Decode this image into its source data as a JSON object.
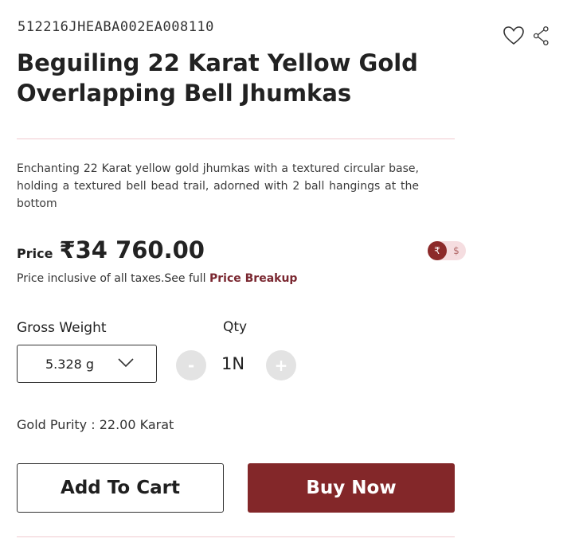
{
  "product": {
    "sku": "512216JHEABA002EA008110",
    "title": "Beguiling 22 Karat Yellow Gold Overlapping Bell Jhumkas",
    "description": "Enchanting 22 Karat yellow gold jhumkas with a textured circular base, holding a textured bell bead trail, adorned with 2 ball hangings at the bottom",
    "purity": "Gold Purity : 22.00 Karat"
  },
  "icons": {
    "wishlist": "heart-icon",
    "share": "share-icon"
  },
  "price": {
    "label": "Price",
    "value": "₹34 760.00",
    "tax_note": "Price inclusive of all taxes.See full ",
    "breakup_link": "Price Breakup"
  },
  "currency": {
    "active": "₹",
    "inactive": "$",
    "active_color": "#8c2a2a"
  },
  "weight": {
    "label": "Gross Weight",
    "selected": "5.328 g"
  },
  "quantity": {
    "label": "Qty",
    "value": "1N",
    "minus": "-",
    "plus": "+"
  },
  "actions": {
    "add_to_cart": "Add To Cart",
    "buy_now": "Buy Now"
  },
  "colors": {
    "brand": "#832729",
    "divider": "#f0c9cf"
  }
}
